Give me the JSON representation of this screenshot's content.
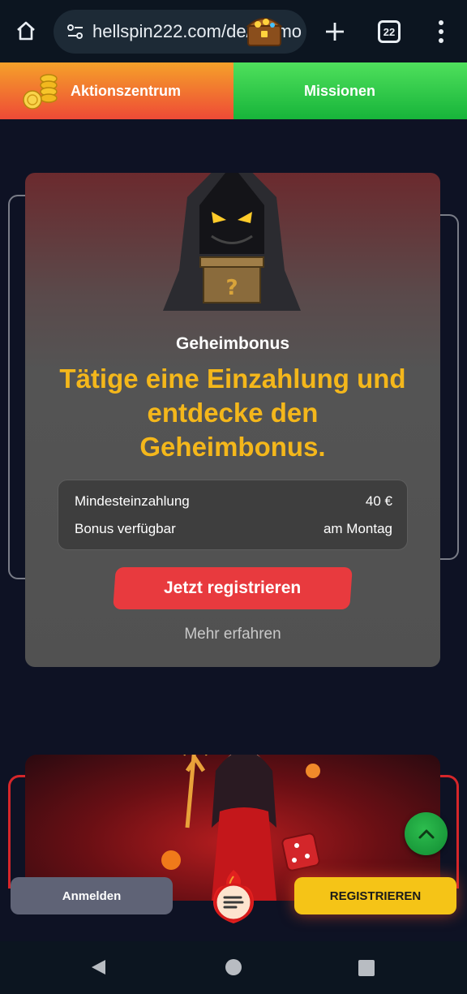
{
  "browser": {
    "url": "hellspin222.com/de/promo",
    "tab_count": "22"
  },
  "nav_tabs": [
    {
      "label": "Aktionszentrum",
      "icon": "coins-icon",
      "color_top": "#f5a12a",
      "color_bottom": "#ee4a36"
    },
    {
      "label": "Missionen",
      "icon": "treasure-chest-icon",
      "color_top": "#4fe05c",
      "color_bottom": "#17b43a"
    }
  ],
  "promo_card": {
    "title": "Geheimbonus",
    "headline": "Tätige eine Einzahlung und entdecke den Geheimbonus.",
    "info": [
      {
        "label": "Mindesteinzahlung",
        "value": "40 €"
      },
      {
        "label": "Bonus verfügbar",
        "value": "am Montag"
      }
    ],
    "cta_label": "Jetzt registrieren",
    "more_label": "Mehr erfahren",
    "art": "hooded-figure-mystery-box"
  },
  "banner": {
    "art": "devil-girl-with-trident-and-dice"
  },
  "bottom_bar": {
    "login_label": "Anmelden",
    "register_label": "REGISTRIEREN"
  },
  "colors": {
    "accent_yellow": "#f4b71b",
    "cta_red": "#e83a3e",
    "register_yellow": "#f5c417",
    "login_gray": "#5f6376",
    "background": "#0e1224"
  }
}
